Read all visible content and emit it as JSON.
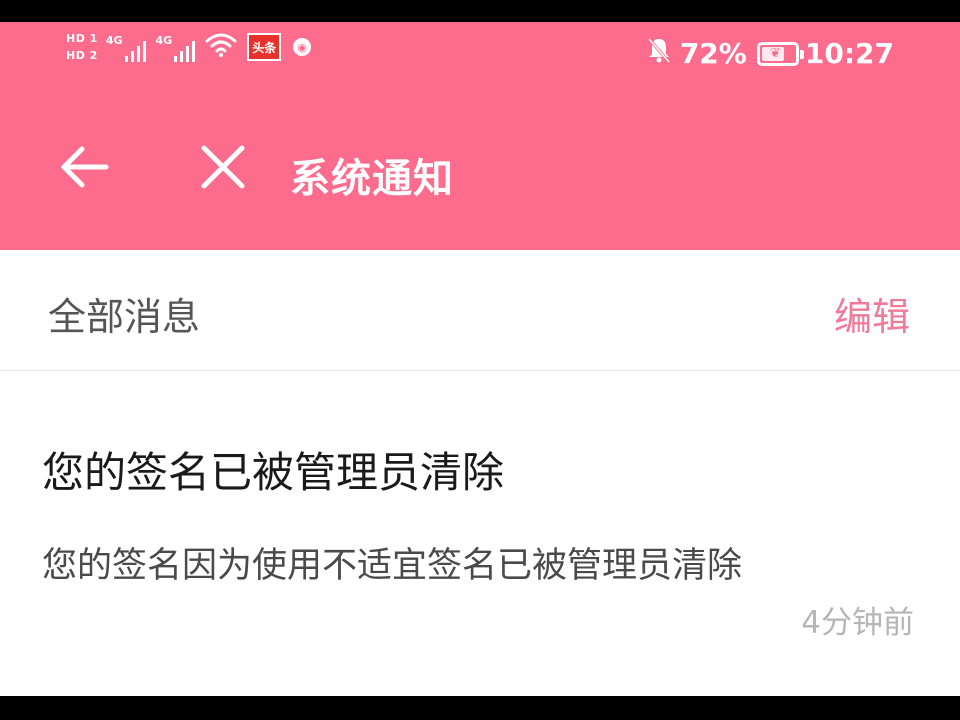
{
  "status_bar": {
    "sim1": "HD 1",
    "sim2": "HD 2",
    "network1": "4G",
    "network2": "4G",
    "news_app": "头条",
    "battery_level": 72,
    "battery_text": "72%",
    "time": "10:27",
    "icons": [
      "wifi-icon",
      "news-app-icon",
      "pig-app-icon",
      "bell-muted-icon",
      "battery-icon"
    ]
  },
  "header": {
    "title": "系统通知",
    "background": "#fd6b8d",
    "back_icon": "arrow-left",
    "close_icon": "close-x"
  },
  "filter": {
    "label": "全部消息",
    "edit_label": "编辑",
    "edit_color": "#f07a9a"
  },
  "notification": {
    "title": "您的签名已被管理员清除",
    "body": "您的签名因为使用不适宜签名已被管理员清除",
    "time": "4分钟前"
  }
}
